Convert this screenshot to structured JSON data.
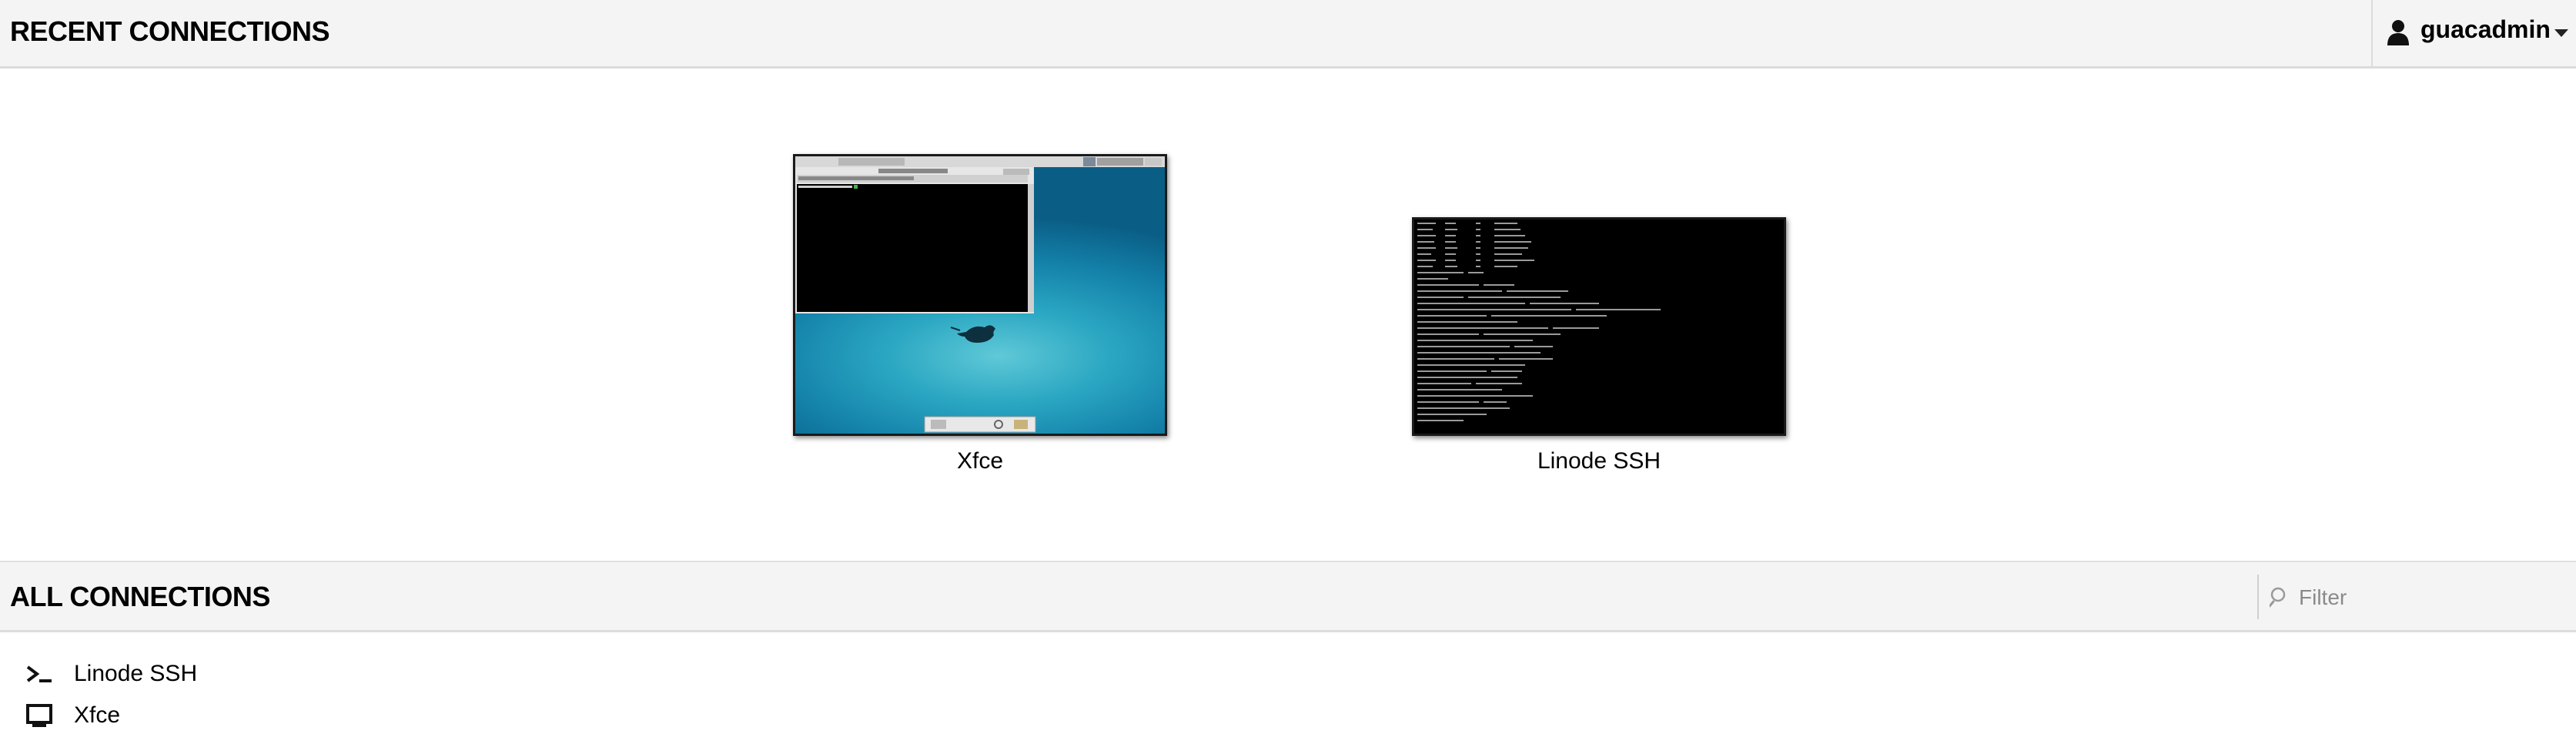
{
  "header": {
    "title": "RECENT CONNECTIONS",
    "user": {
      "name": "guacadmin",
      "icon": "user-icon"
    }
  },
  "recent": [
    {
      "name": "Xfce",
      "preview": "xfce-desktop-thumbnail"
    },
    {
      "name": "Linode SSH",
      "preview": "terminal-thumbnail"
    }
  ],
  "all_connections": {
    "title": "ALL CONNECTIONS",
    "filter": {
      "placeholder": "Filter",
      "value": ""
    },
    "items": [
      {
        "name": "Linode SSH",
        "icon": "terminal-icon"
      },
      {
        "name": "Xfce",
        "icon": "desktop-icon"
      }
    ]
  },
  "colors": {
    "bar_bg": "#f4f4f4",
    "border": "#dcdcdc",
    "text": "#000000"
  }
}
